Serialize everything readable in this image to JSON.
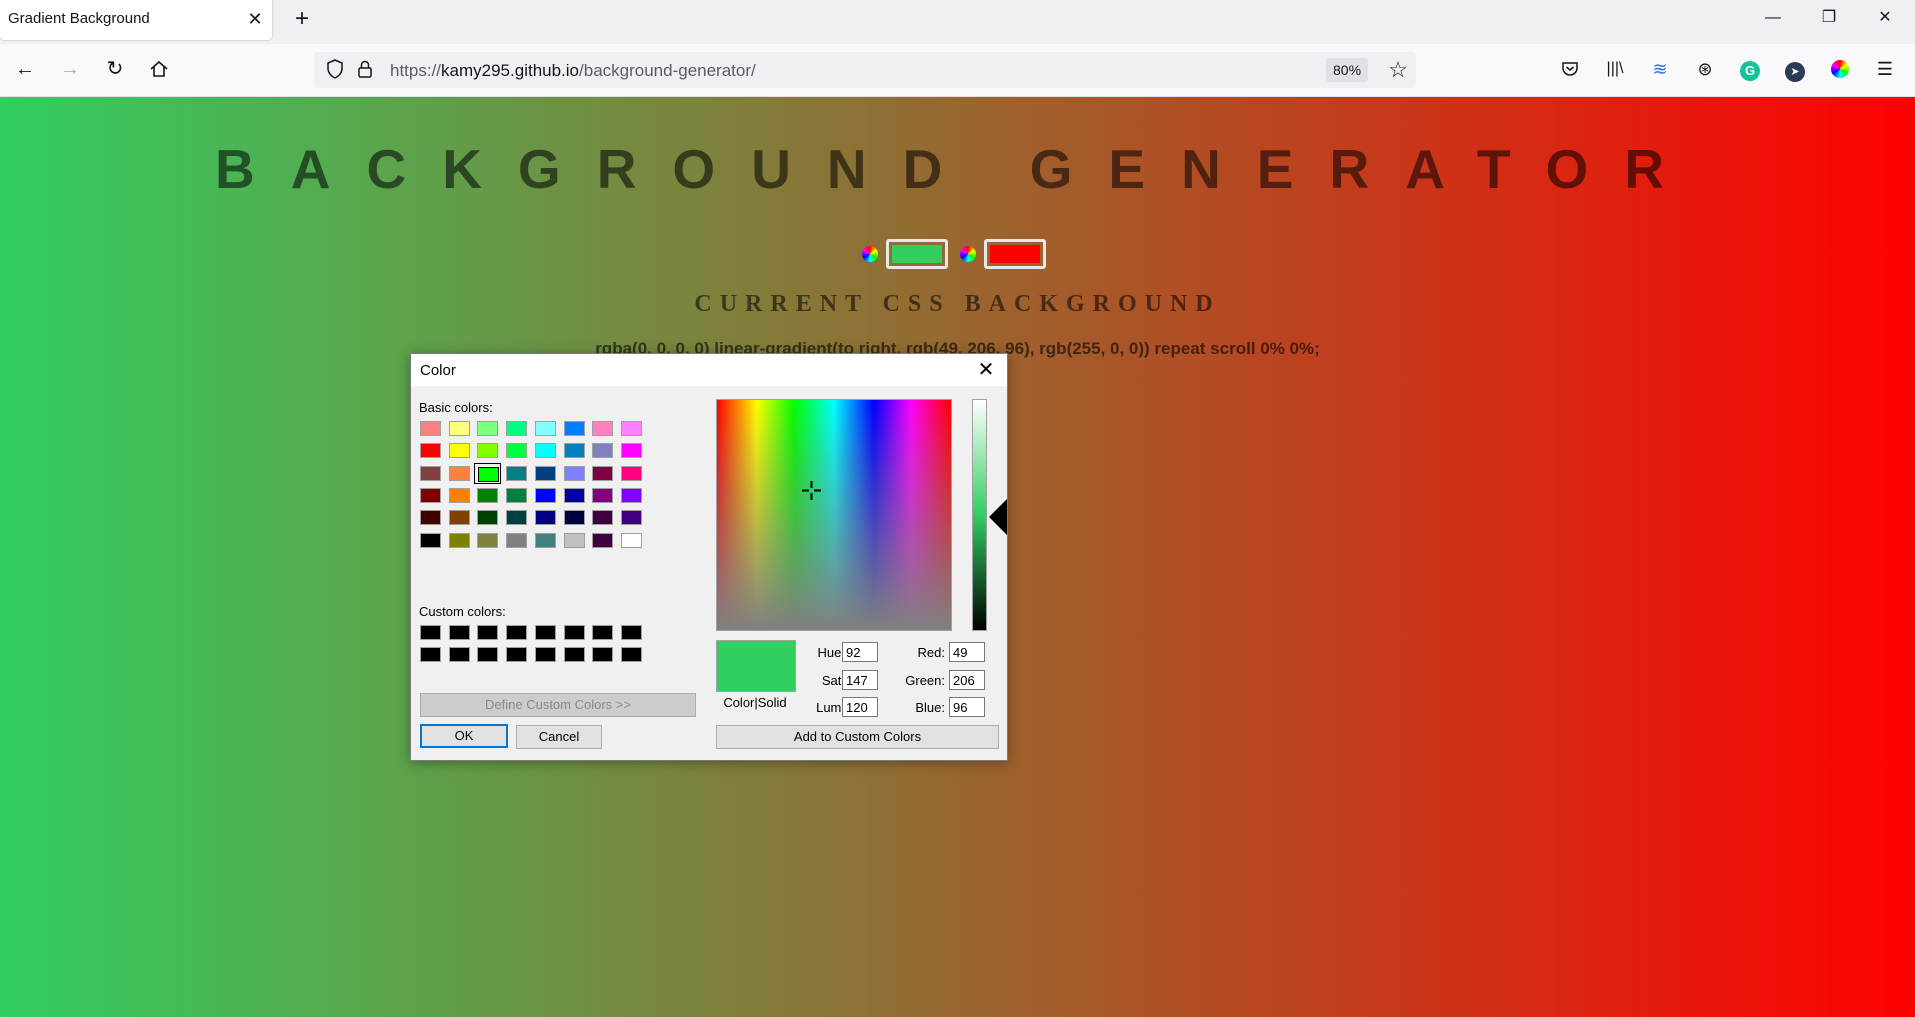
{
  "browser": {
    "tab_title": "Gradient Background",
    "url_prefix": "https://",
    "url_host": "kamy295.github.io",
    "url_path": "/background-generator/",
    "zoom": "80%"
  },
  "page": {
    "heading": "BACKGROUND GENERATOR",
    "color1": "#31ce60",
    "color2": "#ff0000",
    "css_heading": "CURRENT CSS BACKGROUND",
    "css_value": "rgba(0, 0, 0, 0) linear-gradient(to right, rgb(49, 206, 96), rgb(255, 0, 0)) repeat scroll 0% 0%;"
  },
  "dialog": {
    "title": "Color",
    "basic_label": "Basic colors:",
    "basic_colors": [
      [
        "#ff8080",
        "#ffff80",
        "#80ff80",
        "#00ff80",
        "#80ffff",
        "#0080ff",
        "#ff80c0",
        "#ff80ff"
      ],
      [
        "#ff0000",
        "#ffff00",
        "#80ff00",
        "#00ff40",
        "#00ffff",
        "#0080c0",
        "#8080c0",
        "#ff00ff"
      ],
      [
        "#804040",
        "#ff8040",
        "#00ff00",
        "#008080",
        "#004080",
        "#8080ff",
        "#800040",
        "#ff0080"
      ],
      [
        "#800000",
        "#ff8000",
        "#008000",
        "#008040",
        "#0000ff",
        "#0000a0",
        "#800080",
        "#8000ff"
      ],
      [
        "#400000",
        "#804000",
        "#004000",
        "#004040",
        "#000080",
        "#000040",
        "#400040",
        "#400080"
      ],
      [
        "#000000",
        "#808000",
        "#808040",
        "#808080",
        "#408080",
        "#c0c0c0",
        "#400040",
        "#ffffff"
      ]
    ],
    "selected_basic": "#00ff00",
    "custom_label": "Custom colors:",
    "custom_colors": [
      [
        "#000000",
        "#000000",
        "#000000",
        "#000000",
        "#000000",
        "#000000",
        "#000000",
        "#000000"
      ],
      [
        "#000000",
        "#000000",
        "#000000",
        "#000000",
        "#000000",
        "#000000",
        "#000000",
        "#000000"
      ]
    ],
    "define_button": "Define Custom Colors >>",
    "ok_button": "OK",
    "cancel_button": "Cancel",
    "preview_label": "Color|Solid",
    "preview_color": "#31ce60",
    "hue_label": "Hue:",
    "hue_value": "92",
    "sat_label": "Sat:",
    "sat_value": "147",
    "lum_label": "Lum:",
    "lum_value": "120",
    "red_label": "Red:",
    "red_value": "49",
    "green_label": "Green:",
    "green_value": "206",
    "blue_label": "Blue:",
    "blue_value": "96",
    "add_button": "Add to Custom Colors"
  }
}
